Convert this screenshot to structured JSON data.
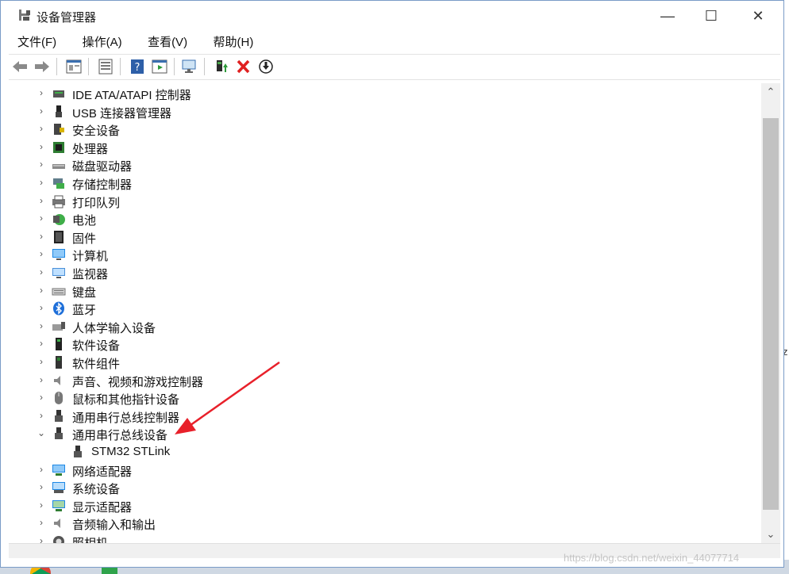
{
  "window": {
    "title": "设备管理器",
    "controls": {
      "minimize": "—",
      "maximize": "☐",
      "close": "✕"
    }
  },
  "menu": [
    {
      "label": "文件(F)"
    },
    {
      "label": "操作(A)"
    },
    {
      "label": "查看(V)"
    },
    {
      "label": "帮助(H)"
    }
  ],
  "toolbar": [
    "back-icon",
    "forward-icon",
    "properties-pane-icon",
    "device-list-icon",
    "help-icon",
    "action-pane-icon",
    "scan-hardware-icon",
    "update-driver-icon",
    "uninstall-device-icon",
    "disable-device-icon"
  ],
  "tree": {
    "items": [
      {
        "label": "IDE ATA/ATAPI 控制器",
        "icon": "ide-controller-icon",
        "expanded": false
      },
      {
        "label": "USB 连接器管理器",
        "icon": "usb-connector-icon",
        "expanded": false
      },
      {
        "label": "安全设备",
        "icon": "security-device-icon",
        "expanded": false
      },
      {
        "label": "处理器",
        "icon": "processor-icon",
        "expanded": false
      },
      {
        "label": "磁盘驱动器",
        "icon": "disk-drive-icon",
        "expanded": false
      },
      {
        "label": "存储控制器",
        "icon": "storage-controller-icon",
        "expanded": false
      },
      {
        "label": "打印队列",
        "icon": "printer-icon",
        "expanded": false
      },
      {
        "label": "电池",
        "icon": "battery-icon",
        "expanded": false
      },
      {
        "label": "固件",
        "icon": "firmware-icon",
        "expanded": false
      },
      {
        "label": "计算机",
        "icon": "computer-icon",
        "expanded": false
      },
      {
        "label": "监视器",
        "icon": "monitor-icon",
        "expanded": false
      },
      {
        "label": "键盘",
        "icon": "keyboard-icon",
        "expanded": false
      },
      {
        "label": "蓝牙",
        "icon": "bluetooth-icon",
        "expanded": false
      },
      {
        "label": "人体学输入设备",
        "icon": "hid-icon",
        "expanded": false
      },
      {
        "label": "软件设备",
        "icon": "software-device-icon",
        "expanded": false
      },
      {
        "label": "软件组件",
        "icon": "software-component-icon",
        "expanded": false
      },
      {
        "label": "声音、视频和游戏控制器",
        "icon": "sound-icon",
        "expanded": false
      },
      {
        "label": "鼠标和其他指针设备",
        "icon": "mouse-icon",
        "expanded": false
      },
      {
        "label": "通用串行总线控制器",
        "icon": "usb-controller-icon",
        "expanded": false
      },
      {
        "label": "通用串行总线设备",
        "icon": "usb-device-icon",
        "expanded": true,
        "children": [
          {
            "label": "STM32 STLink",
            "icon": "usb-device-icon"
          }
        ]
      },
      {
        "label": "网络适配器",
        "icon": "network-adapter-icon",
        "expanded": false
      },
      {
        "label": "系统设备",
        "icon": "system-device-icon",
        "expanded": false
      },
      {
        "label": "显示适配器",
        "icon": "display-adapter-icon",
        "expanded": false
      },
      {
        "label": "音频输入和输出",
        "icon": "audio-io-icon",
        "expanded": false
      },
      {
        "label": "照相机",
        "icon": "camera-icon",
        "expanded": false
      }
    ]
  },
  "annotation": {
    "type": "red-arrow",
    "target": "通用串行总线设备"
  },
  "watermark": "https://blog.csdn.net/weixin_44077714",
  "background": {
    "right_edge_text": "z"
  },
  "colors": {
    "accent": "#1e6fb6",
    "annotation": "#e8202a",
    "scroll_thumb": "#c2c2c2"
  }
}
